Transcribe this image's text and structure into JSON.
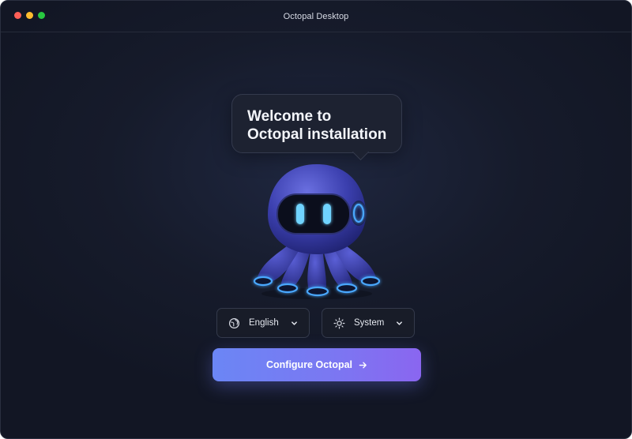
{
  "window": {
    "title": "Octopal Desktop"
  },
  "welcome": {
    "line1": "Welcome to",
    "line2": "Octopal installation"
  },
  "language_select": {
    "value": "English",
    "icon": "globe-icon"
  },
  "theme_select": {
    "value": "System",
    "icon": "sun-icon"
  },
  "primary_button": {
    "label": "Configure Octopal",
    "icon": "arrow-right-icon"
  },
  "colors": {
    "background": "#161b2b",
    "accent_start": "#6b86f5",
    "accent_end": "#8a66f0",
    "mascot_glow": "#4aa8ff"
  }
}
